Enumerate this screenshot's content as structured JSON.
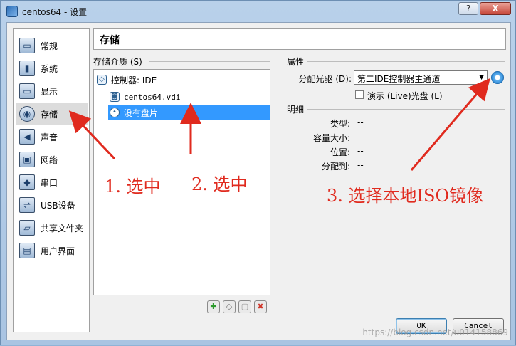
{
  "window": {
    "title": "centos64 - 设置",
    "help_btn": "?",
    "close_btn": "X"
  },
  "sidebar": {
    "items": [
      {
        "label": "常规",
        "icon": "general-icon"
      },
      {
        "label": "系统",
        "icon": "system-icon"
      },
      {
        "label": "显示",
        "icon": "display-icon"
      },
      {
        "label": "存储",
        "icon": "storage-icon",
        "active": true
      },
      {
        "label": "声音",
        "icon": "audio-icon"
      },
      {
        "label": "网络",
        "icon": "network-icon"
      },
      {
        "label": "串口",
        "icon": "serial-port-icon"
      },
      {
        "label": "USB设备",
        "icon": "usb-icon"
      },
      {
        "label": "共享文件夹",
        "icon": "shared-folder-icon"
      },
      {
        "label": "用户界面",
        "icon": "user-interface-icon"
      }
    ]
  },
  "header": {
    "title": "存储"
  },
  "storage": {
    "section_label": "存储介质 (S)",
    "controller": "控制器: IDE",
    "disk": "centos64.vdi",
    "empty_optical": "没有盘片"
  },
  "attributes": {
    "section_label": "属性",
    "drive_label": "分配光驱 (D):",
    "drive_value": "第二IDE控制器主通道",
    "live_cd_label": "演示 (Live)光盘 (L)"
  },
  "details": {
    "section_label": "明细",
    "rows": [
      {
        "label": "类型:",
        "value": "--"
      },
      {
        "label": "容量大小:",
        "value": "--"
      },
      {
        "label": "位置:",
        "value": "--"
      },
      {
        "label": "分配到:",
        "value": "--"
      }
    ]
  },
  "buttons": {
    "ok": "OK",
    "cancel": "Cancel"
  },
  "annotations": {
    "step1": "1. 选中",
    "step2": "2. 选中",
    "step3": "3. 选择本地ISO镜像",
    "color": "#e02a1e"
  },
  "watermark": "https://blog.csdn.net/u014158869"
}
